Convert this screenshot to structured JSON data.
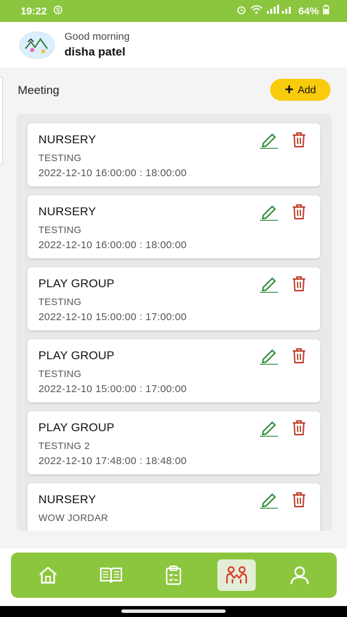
{
  "status_bar": {
    "time": "19:22",
    "time_suffix_icon": "s-badge-icon",
    "battery": "64%",
    "icons": [
      "alarm-icon",
      "wifi-icon",
      "signal-icon",
      "battery-icon"
    ]
  },
  "header": {
    "greeting": "Good morning",
    "user_name": "disha patel"
  },
  "section": {
    "title": "Meeting",
    "add_label": "Add"
  },
  "meetings": [
    {
      "title": "NURSERY",
      "subtitle": "TESTING",
      "time": "2022-12-10 16:00:00 : 18:00:00"
    },
    {
      "title": "NURSERY",
      "subtitle": "TESTING",
      "time": "2022-12-10 16:00:00 : 18:00:00"
    },
    {
      "title": "PLAY GROUP",
      "subtitle": "TESTING",
      "time": "2022-12-10 15:00:00 : 17:00:00"
    },
    {
      "title": "PLAY GROUP",
      "subtitle": "TESTING",
      "time": "2022-12-10 15:00:00 : 17:00:00"
    },
    {
      "title": "PLAY GROUP",
      "subtitle": "TESTING  2",
      "time": "2022-12-10 17:48:00 : 18:48:00"
    },
    {
      "title": "NURSERY",
      "subtitle": "WOW JORDAR",
      "time": ""
    }
  ],
  "bottom_nav": {
    "items": [
      {
        "icon": "home-icon",
        "active": false
      },
      {
        "icon": "book-icon",
        "active": false
      },
      {
        "icon": "clipboard-icon",
        "active": false
      },
      {
        "icon": "meeting-icon",
        "active": true
      },
      {
        "icon": "profile-icon",
        "active": false
      }
    ]
  },
  "colors": {
    "brand_green": "#8cc63e",
    "add_button_yellow": "#f8cb0c",
    "edit_green": "#2e8b3a",
    "delete_red": "#c0392b",
    "active_nav_icon": "#d93b2b"
  }
}
